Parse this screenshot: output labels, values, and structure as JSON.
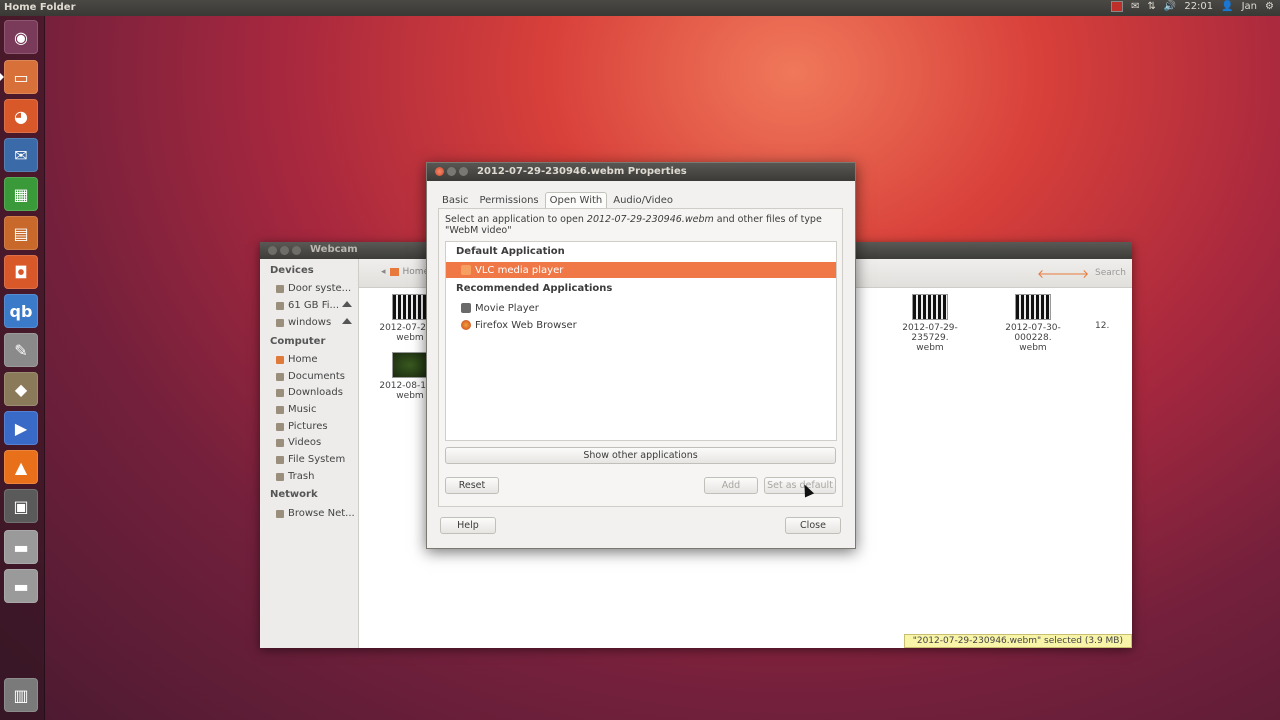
{
  "top_panel": {
    "window_title": "Home Folder",
    "clock": "22:01",
    "user": "Jan"
  },
  "launcher": {
    "items": [
      {
        "name": "dash",
        "glyph": "◉",
        "color": "#7a3a5a"
      },
      {
        "name": "files",
        "glyph": "▭",
        "color": "#d8703a"
      },
      {
        "name": "firefox",
        "glyph": "◕",
        "color": "#d8582a"
      },
      {
        "name": "thunderbird",
        "glyph": "✉",
        "color": "#3a6aa8"
      },
      {
        "name": "libreoffice-calc",
        "glyph": "▦",
        "color": "#3a9a3a"
      },
      {
        "name": "libreoffice-impress",
        "glyph": "▤",
        "color": "#c8682a"
      },
      {
        "name": "software-center",
        "glyph": "◘",
        "color": "#d8582a"
      },
      {
        "name": "qbittorrent",
        "glyph": "qb",
        "color": "#3a7ac8"
      },
      {
        "name": "text-editor",
        "glyph": "✎",
        "color": "#8a8a8a"
      },
      {
        "name": "gimp",
        "glyph": "◆",
        "color": "#8a7a5a"
      },
      {
        "name": "movie-player",
        "glyph": "▶",
        "color": "#3a6ac8"
      },
      {
        "name": "vlc",
        "glyph": "▲",
        "color": "#e8701a"
      },
      {
        "name": "terminal",
        "glyph": "▣",
        "color": "#5a5a5a"
      },
      {
        "name": "drive-1",
        "glyph": "▬",
        "color": "#9a9a9a"
      },
      {
        "name": "drive-2",
        "glyph": "▬",
        "color": "#9a9a9a"
      },
      {
        "name": "trash",
        "glyph": "▥",
        "color": "#7a7a7a"
      }
    ]
  },
  "nautilus": {
    "title": "Webcam",
    "sidebar": {
      "devices_header": "Devices",
      "devices": [
        "Door syste...",
        "61 GB Fi...",
        "windows"
      ],
      "computer_header": "Computer",
      "computer": [
        "Home",
        "Documents",
        "Downloads",
        "Music",
        "Pictures",
        "Videos",
        "File System",
        "Trash"
      ],
      "network_header": "Network",
      "network": [
        "Browse Net..."
      ]
    },
    "breadcrumb": "Home",
    "search_label": "Search",
    "files": [
      {
        "line1": "2012-07-29-2",
        "line2": "webm"
      },
      {
        "line1": "2012-08-14-2",
        "line2": "webm"
      },
      {
        "line1": "12.",
        "line2": ""
      },
      {
        "line1": "2012-07-29-235729.",
        "line2": "webm"
      },
      {
        "line1": "2012-07-30-000228.",
        "line2": "webm"
      }
    ],
    "status": "\"2012-07-29-230946.webm\" selected (3.9 MB)"
  },
  "dialog": {
    "title": "2012-07-29-230946.webm Properties",
    "tabs": [
      "Basic",
      "Permissions",
      "Open With",
      "Audio/Video"
    ],
    "active_tab": "Open With",
    "description_prefix": "Select an application to open ",
    "description_file": "2012-07-29-230946.webm",
    "description_suffix": " and other files of type \"WebM video\"",
    "default_header": "Default Application",
    "default_app": "VLC media player",
    "recommended_header": "Recommended Applications",
    "recommended": [
      "Movie Player",
      "Firefox Web Browser"
    ],
    "show_other": "Show other applications",
    "reset": "Reset",
    "add": "Add",
    "set_default": "Set as default",
    "help": "Help",
    "close": "Close"
  },
  "colors": {
    "accent": "#f07746",
    "status_bg": "#f8f4a8"
  }
}
